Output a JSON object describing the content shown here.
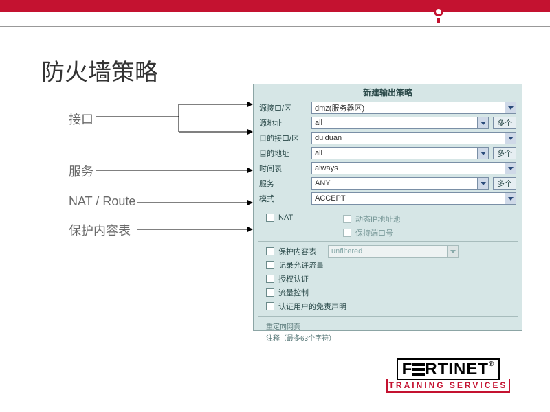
{
  "slide": {
    "title": "防火墙策略"
  },
  "annotations": {
    "interface": "接口",
    "service": "服务",
    "nat": "NAT / Route",
    "profile": "保护内容表"
  },
  "panel": {
    "title": "新建输出策略",
    "rows": {
      "src_if": {
        "label": "源接口/区",
        "value": "dmz(服务器区)"
      },
      "src_addr": {
        "label": "源地址",
        "value": "all",
        "multi": "多个"
      },
      "dst_if": {
        "label": "目的接口/区",
        "value": "duiduan"
      },
      "dst_addr": {
        "label": "目的地址",
        "value": "all",
        "multi": "多个"
      },
      "schedule": {
        "label": "时间表",
        "value": "always"
      },
      "service": {
        "label": "服务",
        "value": "ANY",
        "multi": "多个"
      },
      "action": {
        "label": "模式",
        "value": "ACCEPT"
      }
    },
    "nat": {
      "label": "NAT",
      "dyn_ip": "动态IP地址池",
      "keep_port": "保持端口号"
    },
    "options": {
      "profile": {
        "label": "保护内容表",
        "value": "unfiltered"
      },
      "log_allowed": "记录允许流量",
      "auth": "授权认证",
      "traffic_shaping": "流量控制",
      "disclaimer": "认证用户的免责声明"
    },
    "redirect": {
      "label": "重定向网页"
    },
    "comment_hint": "注释（最多63个字符）"
  },
  "logo": {
    "brand": "F   RTINET",
    "sub": "TRAINING SERVICES"
  }
}
